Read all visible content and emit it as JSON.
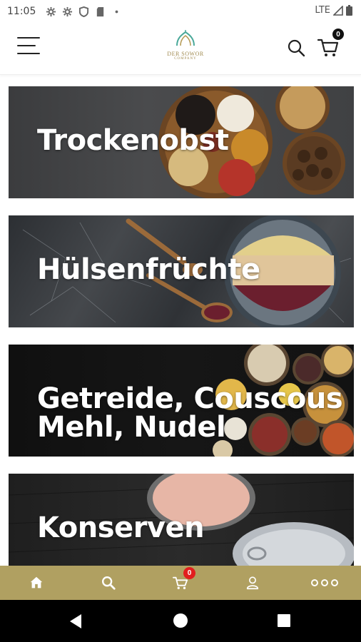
{
  "status_bar": {
    "time": "11:05",
    "network": "LTE",
    "icons": [
      "gear-icon",
      "gear-icon",
      "shield-icon",
      "sd-card-icon",
      "dot-icon"
    ]
  },
  "header": {
    "logo_text": "DER SOWOR",
    "logo_sub": "COMPANY",
    "cart_count": "0"
  },
  "categories": [
    {
      "title_line1": "Trockenobst",
      "title_line2": ""
    },
    {
      "title_line1": "Hülsenfrüchte",
      "title_line2": ""
    },
    {
      "title_line1": "Getreide, Couscous",
      "title_line2": "Mehl, Nudel"
    },
    {
      "title_line1": "Konserven",
      "title_line2": ""
    }
  ],
  "bottom_nav": {
    "items": [
      "home-icon",
      "search-icon",
      "cart-icon",
      "user-icon",
      "more-icon"
    ],
    "cart_count": "0",
    "background": "#b0a061"
  }
}
